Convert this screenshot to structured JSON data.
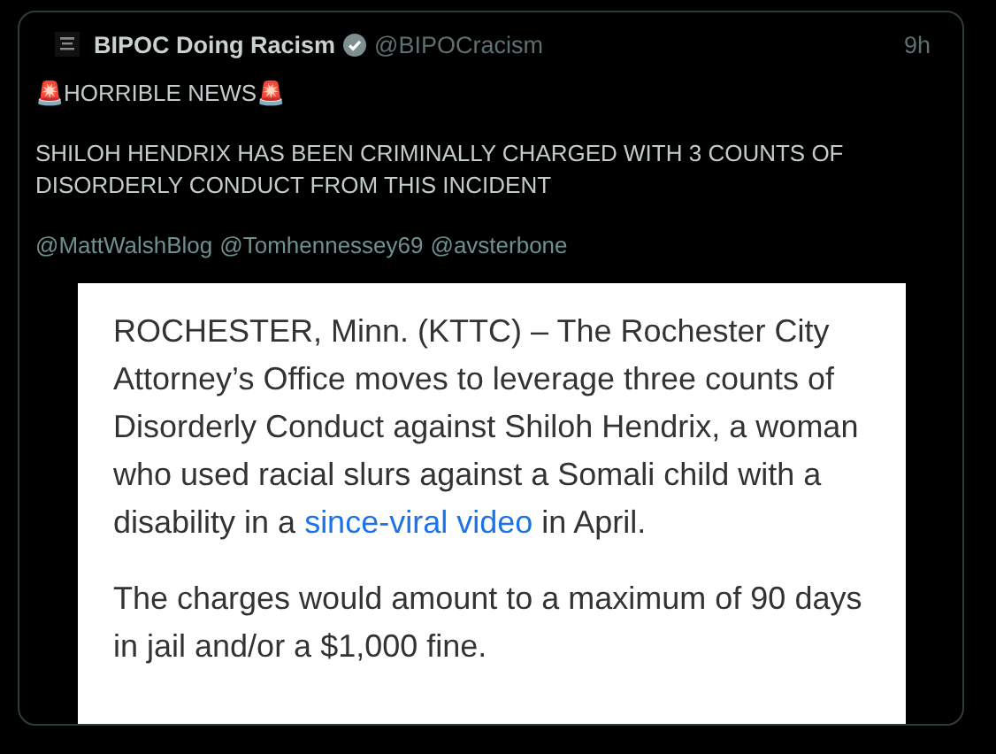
{
  "tweet": {
    "author": "BIPOC Doing Racism",
    "verified": true,
    "handle": "@BIPOCracism",
    "time": "9h",
    "headline": "🚨HORRIBLE NEWS🚨",
    "body": "SHILOH HENDRIX HAS BEEN CRIMINALLY CHARGED WITH 3 COUNTS OF DISORDERLY CONDUCT FROM THIS INCIDENT",
    "mentions": [
      "@MattWalshBlog",
      "@Tomhennessey69",
      "@avsterbone"
    ],
    "article": {
      "paragraphs": [
        {
          "before": "ROCHESTER, Minn. (KTTC) – The Rochester City Attorney’s Office moves to leverage three counts of Disorderly Conduct against Shiloh Hendrix, a woman who used racial slurs against a Somali child with a disability in a ",
          "link": "since-viral video",
          "after": " in April."
        },
        {
          "before": "The charges would amount to a maximum of 90 days in jail and/or a $1,000 fine."
        }
      ]
    }
  }
}
